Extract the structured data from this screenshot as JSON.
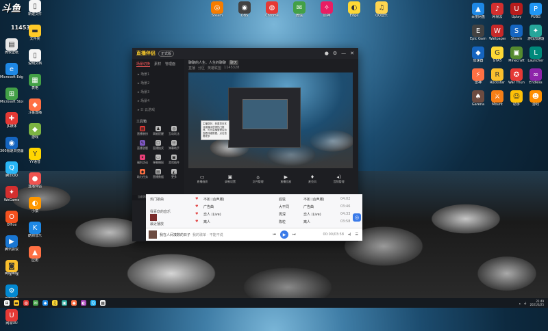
{
  "watermark": {
    "logo": "斗鱼",
    "room_count": "1145328"
  },
  "desktop": {
    "left_column": [
      {
        "label": "微软壁纸",
        "color": "#e8e8e8",
        "glyph": "▤"
      },
      {
        "label": "Microsoft Edge",
        "color": "#1e88e5",
        "glyph": "e"
      },
      {
        "label": "Microsoft Store",
        "color": "#43a047",
        "glyph": "⊞"
      },
      {
        "label": "多媒体",
        "color": "#e53935",
        "glyph": "✚"
      },
      {
        "label": "360极速浏览器",
        "color": "#1565c0",
        "glyph": "◉"
      },
      {
        "label": "腾讯QQ",
        "color": "#29b6f6",
        "glyph": "Q"
      },
      {
        "label": "WeGame",
        "color": "#d32f2f",
        "glyph": "✦"
      },
      {
        "label": "Office",
        "color": "#f4511e",
        "glyph": "O"
      },
      {
        "label": "腾讯会议",
        "color": "#1976d2",
        "glyph": "▶"
      },
      {
        "label": "哔哩哔哩",
        "color": "#fbc02d",
        "glyph": "◙"
      },
      {
        "label": "控制面板",
        "color": "#0288d1",
        "glyph": "⚙"
      },
      {
        "label": "网易UU",
        "color": "#e53935",
        "glyph": "U"
      }
    ],
    "second_column": [
      {
        "label": "新建文件",
        "color": "#f5f5f5",
        "glyph": "▯"
      },
      {
        "label": "文件夹",
        "color": "#ffca28",
        "glyph": "▬"
      },
      {
        "label": "说明文档",
        "color": "#f5f5f5",
        "glyph": "▯"
      },
      {
        "label": "表格",
        "color": "#43a047",
        "glyph": "▦"
      },
      {
        "label": "斗鱼直播",
        "color": "#ff7043",
        "glyph": "◆"
      },
      {
        "label": "游戏",
        "color": "#7cb342",
        "glyph": "◆"
      },
      {
        "label": "YY语音",
        "color": "#ffd600",
        "glyph": "Y"
      },
      {
        "label": "直播伴侣",
        "color": "#ef5350",
        "glyph": "●"
      },
      {
        "label": "小猿",
        "color": "#ff9800",
        "glyph": "◐"
      },
      {
        "label": "酷狗音乐",
        "color": "#1e88e5",
        "glyph": "K"
      },
      {
        "label": "应用",
        "color": "#ff7043",
        "glyph": "▲"
      }
    ],
    "top_row": [
      {
        "label": "Steam",
        "color": "#f57c00",
        "glyph": "◎"
      },
      {
        "label": "OBS",
        "color": "#424242",
        "glyph": "◉"
      },
      {
        "label": "Chrome",
        "color": "#e53935",
        "glyph": "◍"
      },
      {
        "label": "微信",
        "color": "#43a047",
        "glyph": "✉"
      },
      {
        "label": "原神",
        "color": "#e91e63",
        "glyph": "✧"
      },
      {
        "label": "Edge",
        "color": "#fdd835",
        "glyph": "◐"
      },
      {
        "label": "QQ音乐",
        "color": "#ffd54f",
        "glyph": "♫"
      }
    ],
    "right_grid": [
      {
        "label": "百度网盘",
        "color": "#1e88e5",
        "glyph": "▲"
      },
      {
        "label": "网易云",
        "color": "#d32f2f",
        "glyph": "♪"
      },
      {
        "label": "Uplay",
        "color": "#b71c1c",
        "glyph": "U"
      },
      {
        "label": "PUBG",
        "color": "#2196f3",
        "glyph": "P"
      },
      {
        "label": "Epic Games",
        "color": "#424242",
        "glyph": "E"
      },
      {
        "label": "Wallpaper",
        "color": "#c62828",
        "glyph": "W"
      },
      {
        "label": "Steam",
        "color": "#1565c0",
        "glyph": "S"
      },
      {
        "label": "游戏加速器",
        "color": "#26a69a",
        "glyph": "✦"
      },
      {
        "label": "加速器",
        "color": "#1565c0",
        "glyph": "◆"
      },
      {
        "label": "GTA5",
        "color": "#fdd835",
        "glyph": "G"
      },
      {
        "label": "Minecraft",
        "color": "#558b2f",
        "glyph": "▣"
      },
      {
        "label": "Launcher",
        "color": "#00897b",
        "glyph": "L"
      },
      {
        "label": "雷神",
        "color": "#ff7043",
        "glyph": "⚡"
      },
      {
        "label": "Rockstar",
        "color": "#fbc02d",
        "glyph": "R"
      },
      {
        "label": "War Thunder",
        "color": "#e53935",
        "glyph": "✪"
      },
      {
        "label": "Endless",
        "color": "#8e24aa",
        "glyph": "∞"
      },
      {
        "label": "Garena",
        "color": "#6d4c41",
        "glyph": "♠"
      },
      {
        "label": "Mount",
        "color": "#f57f17",
        "glyph": "⚔"
      },
      {
        "label": "助手",
        "color": "#ffc107",
        "glyph": "☺"
      },
      {
        "label": "游戏",
        "color": "#ff8f00",
        "glyph": "☻"
      }
    ]
  },
  "app": {
    "logo": "直播伴侣",
    "version": "正式版",
    "sidebar_tabs": [
      "场景切换",
      "素材",
      "管理面"
    ],
    "scenes": [
      "▸ 场景1",
      "▸ 场景2",
      "▸ 场景3",
      "▸ 场景4",
      "▸ ☷ 云游戏"
    ],
    "tools_label": "工具箱",
    "tools": [
      {
        "label": "直播装扮",
        "color": "#e53935",
        "glyph": "▦"
      },
      {
        "label": "高能提醒",
        "color": "#bdbdbd",
        "glyph": "♟"
      },
      {
        "label": "互动玩法",
        "color": "#bdbdbd",
        "glyph": "◎"
      },
      {
        "label": "直播答题",
        "color": "#7e57c2",
        "glyph": "✎"
      },
      {
        "label": "直播抽奖",
        "color": "#bdbdbd",
        "glyph": "☐"
      },
      {
        "label": "弹幕助手",
        "color": "#bdbdbd",
        "glyph": "☷"
      },
      {
        "label": "福利活动",
        "color": "#ec407a",
        "glyph": "✦"
      },
      {
        "label": "弹幕播报",
        "color": "#bdbdbd",
        "glyph": "▭"
      },
      {
        "label": "游戏插件",
        "color": "#bdbdbd",
        "glyph": "▣"
      },
      {
        "label": "助力任务",
        "color": "#ff7043",
        "glyph": "◆"
      },
      {
        "label": "直播数据",
        "color": "#bdbdbd",
        "glyph": "▤"
      },
      {
        "label": "更多",
        "color": "#bdbdbd",
        "glyph": "◭"
      }
    ],
    "stream_title": "聊聊的人生、人生的聊聊",
    "stream_badge": "聊天",
    "stream_meta": [
      "直播",
      "分区",
      "英雄联盟",
      "1145328"
    ],
    "bottom_tools": [
      {
        "label": "直播画质",
        "glyph": "▭"
      },
      {
        "label": "录制设置",
        "glyph": "▣"
      },
      {
        "label": "文件管理",
        "glyph": "⌂"
      },
      {
        "label": "直播回放",
        "glyph": "▶"
      },
      {
        "label": "麦克风",
        "glyph": "♦"
      },
      {
        "label": "音频管理",
        "glyph": "◂)"
      }
    ],
    "tooltip": "主播您好，恭喜您在本月直播中获得热门推荐，可在直播管理后台查看详细数据，点击查看更多",
    "notice": "当前网络状态良好，祝您直播愉快，如有问题请联系客服"
  },
  "music": {
    "rows": [
      {
        "title": "不如 (合声版)",
        "artist": "后弦",
        "album": "不如 (合声版)",
        "time": "04:02"
      },
      {
        "title": "广告曲",
        "artist": "大不同",
        "album": "广告曲",
        "time": "03:46"
      },
      {
        "title": "恋人 (Live)",
        "artist": "周深",
        "album": "恋人 (Live)",
        "time": "04:33"
      },
      {
        "title": "离人",
        "artist": "陈粒",
        "album": "离人",
        "time": "03:58"
      }
    ],
    "left_items": [
      "热门歌曲",
      "我喜欢的音乐",
      "最近播放"
    ],
    "now_playing": "我在人间凑数的日子",
    "now_artist": "我的歌单 · 不能不说",
    "progress_time": "00:00/03:58"
  },
  "taskbar": {
    "apps": [
      {
        "color": "#ffffff",
        "glyph": "⊞"
      },
      {
        "color": "#ffca28",
        "glyph": "▬"
      },
      {
        "color": "#e53935",
        "glyph": "◍"
      },
      {
        "color": "#43a047",
        "glyph": "✉"
      },
      {
        "color": "#1e88e5",
        "glyph": "◆"
      },
      {
        "color": "#fdd835",
        "glyph": "♫"
      },
      {
        "color": "#26a69a",
        "glyph": "▣"
      },
      {
        "color": "#ff7043",
        "glyph": "◆"
      },
      {
        "color": "#ab47bc",
        "glyph": "◐"
      },
      {
        "color": "#29b6f6",
        "glyph": "Q"
      },
      {
        "color": "#ffffff",
        "glyph": "▦"
      }
    ],
    "time": "21:49",
    "date": "2021/3/25"
  }
}
